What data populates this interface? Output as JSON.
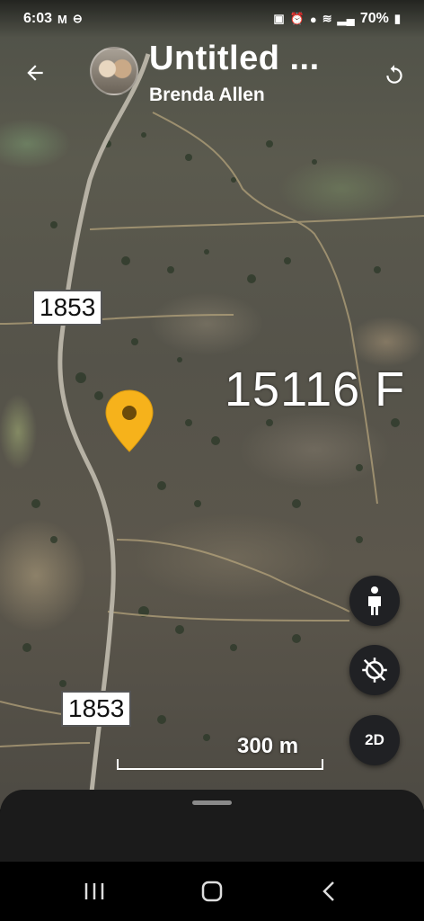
{
  "status_bar": {
    "time": "6:03",
    "battery": "70%",
    "left_icons": [
      "gmail-icon",
      "do-not-disturb-icon"
    ],
    "right_icons": [
      "photo-icon",
      "alarm-icon",
      "location-icon",
      "wifi-icon",
      "signal-icon",
      "battery-icon"
    ]
  },
  "header": {
    "title": "Untitled ...",
    "subtitle": "Brenda Allen",
    "back_icon": "arrow-back-icon",
    "refresh_icon": "refresh-icon"
  },
  "map": {
    "road_labels": [
      "1853",
      "1853"
    ],
    "elevation_label": "15116 F",
    "pin_color": "#F6B21B",
    "scale_text": "300 m"
  },
  "controls": {
    "person_icon": "person-icon",
    "compass_icon": "location-off-icon",
    "view_mode_label": "2D"
  },
  "colors": {
    "fab_background": "#202124",
    "sheet_background": "#1b1b1b"
  },
  "nav_bar": {
    "icons": [
      "recent-apps-icon",
      "home-icon",
      "back-icon"
    ]
  }
}
